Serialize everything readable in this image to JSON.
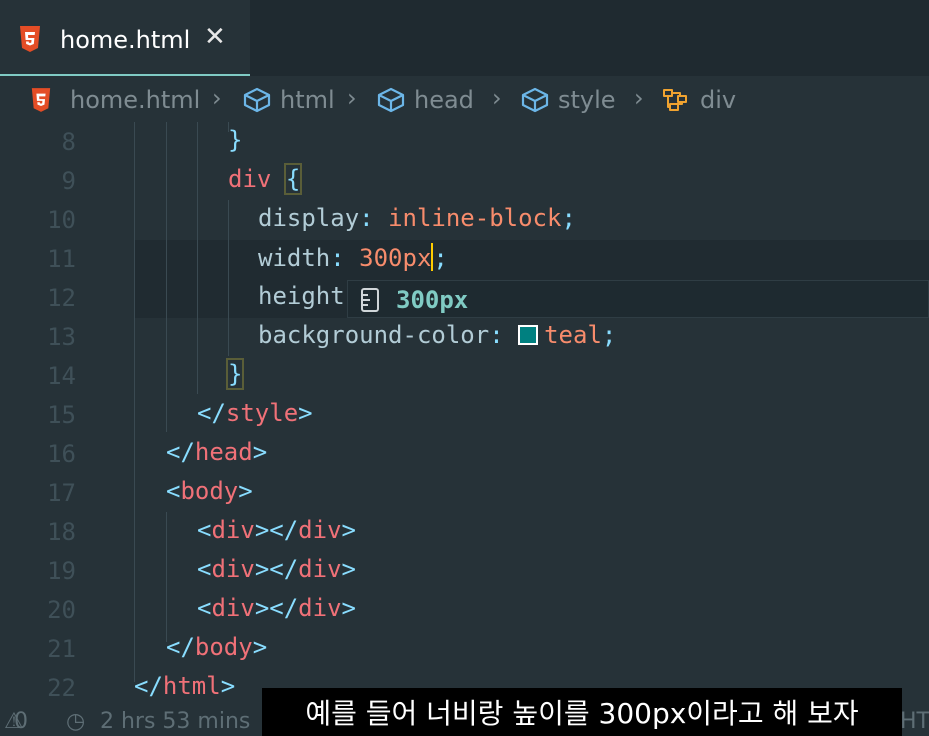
{
  "tab": {
    "filename": "home.html",
    "close": "✕"
  },
  "breadcrumb": [
    {
      "label": "home.html",
      "icon": "html5-icon"
    },
    {
      "label": "html",
      "icon": "cube-icon"
    },
    {
      "label": "head",
      "icon": "cube-icon"
    },
    {
      "label": "style",
      "icon": "cube-icon"
    },
    {
      "label": "div",
      "icon": "selector-icon"
    }
  ],
  "editor": {
    "lines": [
      {
        "n": "8",
        "t": "}"
      },
      {
        "n": "9",
        "t": "div {"
      },
      {
        "n": "10",
        "prop": "display",
        "val": "inline-block"
      },
      {
        "n": "11",
        "prop": "width",
        "val": "300px"
      },
      {
        "n": "12",
        "prop": "height"
      },
      {
        "n": "13",
        "prop": "background-color",
        "val": "teal"
      },
      {
        "n": "14",
        "t": "}"
      },
      {
        "n": "15",
        "tag": "style",
        "close": true
      },
      {
        "n": "16",
        "tag": "head",
        "close": true
      },
      {
        "n": "17",
        "tag": "body"
      },
      {
        "n": "18",
        "tag": "div",
        "pair": true
      },
      {
        "n": "19",
        "tag": "div",
        "pair": true
      },
      {
        "n": "20",
        "tag": "div",
        "pair": true
      },
      {
        "n": "21",
        "tag": "body",
        "close": true
      },
      {
        "n": "22",
        "tag": "html",
        "close": true
      }
    ],
    "suggestion": "300px",
    "swatch_color": "#008080"
  },
  "status": {
    "problems": "0",
    "time": "2 hrs 53 mins",
    "lang": "HTM"
  },
  "subtitle": "예를 들어 너비랑 높이를 300px이라고 해 보자"
}
